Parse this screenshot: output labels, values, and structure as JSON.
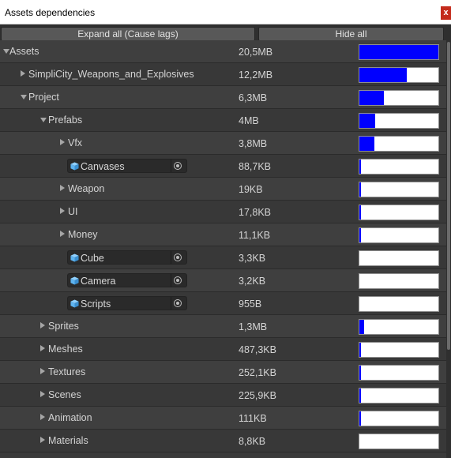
{
  "window": {
    "title": "Assets dependencies",
    "close_glyph": "x"
  },
  "toolbar": {
    "expand_label": "Expand all (Cause lags)",
    "hide_label": "Hide all"
  },
  "rows": [
    {
      "label": "Assets",
      "size": "20,5MB",
      "fraction": 1.0,
      "depth": 0,
      "arrow": "down",
      "kind": "folder"
    },
    {
      "label": "SimpliCity_Weapons_and_Explosives",
      "size": "12,2MB",
      "fraction": 0.595,
      "depth": 1,
      "arrow": "right",
      "kind": "folder"
    },
    {
      "label": "Project",
      "size": "6,3MB",
      "fraction": 0.307,
      "depth": 1,
      "arrow": "down",
      "kind": "folder"
    },
    {
      "label": "Prefabs",
      "size": "4MB",
      "fraction": 0.195,
      "depth": 2,
      "arrow": "down",
      "kind": "folder"
    },
    {
      "label": "Vfx",
      "size": "3,8MB",
      "fraction": 0.185,
      "depth": 3,
      "arrow": "right",
      "kind": "folder"
    },
    {
      "label": "Canvases",
      "size": "88,7KB",
      "fraction": 0.004,
      "depth": 3,
      "arrow": "none",
      "kind": "object"
    },
    {
      "label": "Weapon",
      "size": "19KB",
      "fraction": 0.001,
      "depth": 3,
      "arrow": "right",
      "kind": "folder"
    },
    {
      "label": "UI",
      "size": "17,8KB",
      "fraction": 0.001,
      "depth": 3,
      "arrow": "right",
      "kind": "folder"
    },
    {
      "label": "Money",
      "size": "11,1KB",
      "fraction": 0.001,
      "depth": 3,
      "arrow": "right",
      "kind": "folder"
    },
    {
      "label": "Cube",
      "size": "3,3KB",
      "fraction": 0.0,
      "depth": 3,
      "arrow": "none",
      "kind": "object"
    },
    {
      "label": "Camera",
      "size": "3,2KB",
      "fraction": 0.0,
      "depth": 3,
      "arrow": "none",
      "kind": "object"
    },
    {
      "label": "Scripts",
      "size": "955B",
      "fraction": 0.0,
      "depth": 3,
      "arrow": "none",
      "kind": "object"
    },
    {
      "label": "Sprites",
      "size": "1,3MB",
      "fraction": 0.063,
      "depth": 2,
      "arrow": "right",
      "kind": "folder"
    },
    {
      "label": "Meshes",
      "size": "487,3KB",
      "fraction": 0.023,
      "depth": 2,
      "arrow": "right",
      "kind": "folder"
    },
    {
      "label": "Textures",
      "size": "252,1KB",
      "fraction": 0.012,
      "depth": 2,
      "arrow": "right",
      "kind": "folder"
    },
    {
      "label": "Scenes",
      "size": "225,9KB",
      "fraction": 0.011,
      "depth": 2,
      "arrow": "right",
      "kind": "folder"
    },
    {
      "label": "Animation",
      "size": "111KB",
      "fraction": 0.005,
      "depth": 2,
      "arrow": "right",
      "kind": "folder"
    },
    {
      "label": "Materials",
      "size": "8,8KB",
      "fraction": 0.0,
      "depth": 2,
      "arrow": "right",
      "kind": "folder"
    }
  ],
  "colors": {
    "bar_fill": "#0000ff",
    "bar_empty": "#ffffff",
    "object_icon": "#5fb4f0"
  }
}
